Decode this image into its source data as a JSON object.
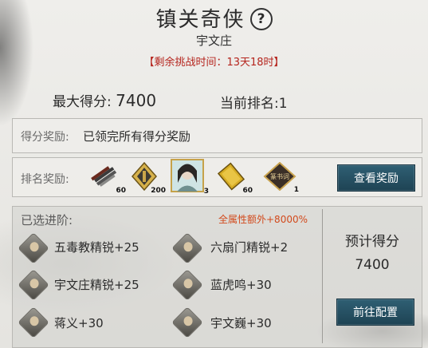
{
  "header": {
    "title": "镇关奇侠",
    "subtitle": "宇文庄",
    "remaining": "【剩余挑战时间：13天18时】"
  },
  "stats": {
    "max_score_label": "最大得分:",
    "max_score_value": "7400",
    "rank_label": "当前排名:",
    "rank_value": "1"
  },
  "score_reward": {
    "label": "得分奖励:",
    "text": "已领完所有得分奖励"
  },
  "rank_reward": {
    "label": "排名奖励:",
    "items": [
      {
        "name": "blade-bundle-icon",
        "qty": "60"
      },
      {
        "name": "banner-icon",
        "qty": "200"
      },
      {
        "name": "character-portrait-icon",
        "qty": "3"
      },
      {
        "name": "gold-book-icon",
        "qty": "60"
      },
      {
        "name": "plaque-icon",
        "qty": "1",
        "text": "篆书词"
      }
    ],
    "view_button": "查看奖励"
  },
  "advanced": {
    "label": "已选进阶:",
    "bonus": "全属性额外+8000%",
    "members": [
      {
        "text": "五毒教精锐+25"
      },
      {
        "text": "六扇门精锐+2"
      },
      {
        "text": "宇文庄精锐+25"
      },
      {
        "text": "蓝虎鸣+30"
      },
      {
        "text": "蒋义+30"
      },
      {
        "text": "宇文巍+30"
      }
    ]
  },
  "estimate": {
    "label": "预计得分",
    "value": "7400",
    "button": "前往配置"
  },
  "colors": {
    "accent": "#b5241d",
    "button": "#285366"
  }
}
